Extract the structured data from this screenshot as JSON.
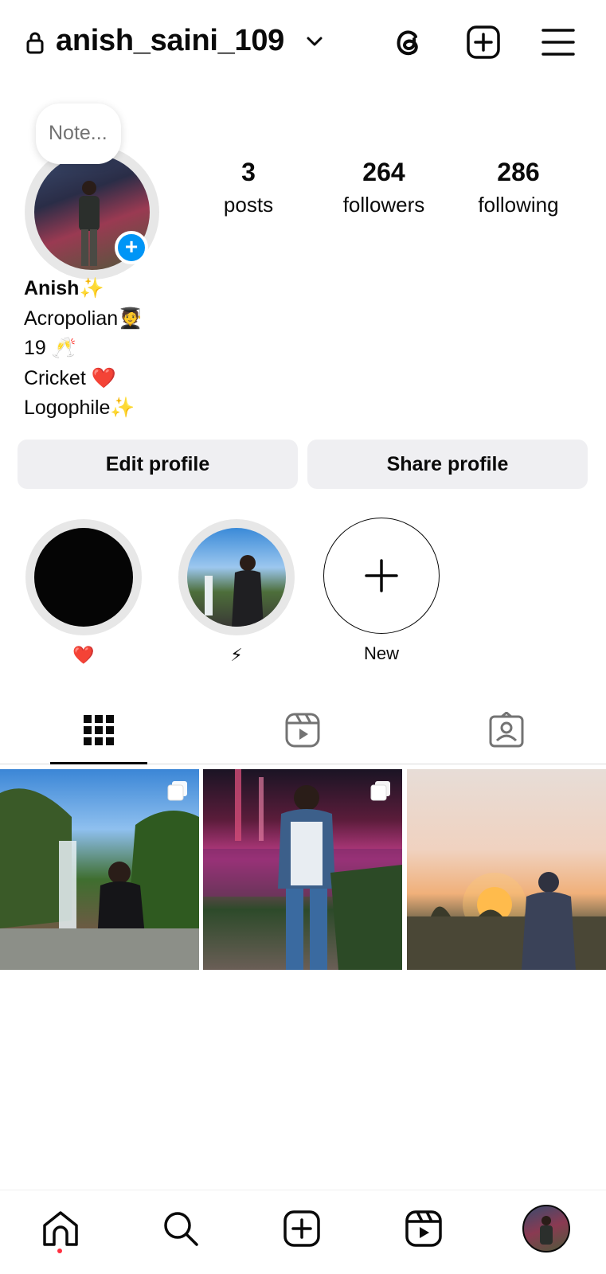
{
  "header": {
    "username": "anish_saini_109",
    "icons": [
      "lock-icon",
      "chevron-down-icon",
      "threads-icon",
      "new-post-icon",
      "menu-icon"
    ]
  },
  "note": {
    "placeholder": "Note..."
  },
  "stats": {
    "posts": {
      "count": "3",
      "label": "posts"
    },
    "followers": {
      "count": "264",
      "label": "followers"
    },
    "following": {
      "count": "286",
      "label": "following"
    }
  },
  "bio": {
    "name": "Anish✨",
    "lines": [
      "Acropolian🧑‍🎓",
      "19 🥂",
      "Cricket ❤️",
      "Logophile✨"
    ]
  },
  "buttons": {
    "edit": "Edit profile",
    "share": "Share profile"
  },
  "highlights": [
    {
      "caption": "❤️"
    },
    {
      "caption": "⚡"
    },
    {
      "caption": "New"
    }
  ],
  "tabs": [
    "grid-icon",
    "reels-icon",
    "tagged-icon"
  ],
  "posts": [
    {
      "multi": true
    },
    {
      "multi": true
    },
    {
      "multi": false
    }
  ],
  "bottom_nav": [
    "home-icon",
    "search-icon",
    "create-icon",
    "reels-icon",
    "profile-avatar"
  ],
  "colors": {
    "accent": "#0095f6",
    "button_bg": "#efeff2",
    "notification": "#ff3040"
  }
}
